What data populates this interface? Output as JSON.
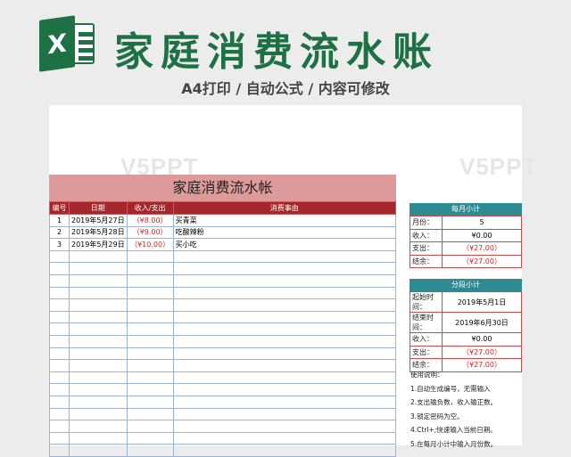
{
  "banner": {
    "logo_letter": "X",
    "title": "家庭消费流水账",
    "subtitle": "A4打印 / 自动公式 / 内容可修改"
  },
  "watermark": "V5PPT",
  "sheet": {
    "title": "家庭消费流水帐",
    "columns": [
      "编号",
      "日期",
      "收入/支出",
      "消费事由"
    ],
    "rows": [
      {
        "no": "1",
        "date": "2019年5月27日",
        "amount": "（¥8.00）",
        "desc": "买青菜"
      },
      {
        "no": "2",
        "date": "2019年5月28日",
        "amount": "（¥9.00）",
        "desc": "吃酸辣粉"
      },
      {
        "no": "3",
        "date": "2019年5月29日",
        "amount": "（¥10.00）",
        "desc": "买小吃"
      }
    ],
    "empty_rows": 17
  },
  "monthly": {
    "title": "每月小计",
    "rows": [
      {
        "label": "月份：",
        "value": "5",
        "red": false
      },
      {
        "label": "收入：",
        "value": "¥0.00",
        "red": false
      },
      {
        "label": "支出：",
        "value": "（¥27.00）",
        "red": true
      },
      {
        "label": "结余：",
        "value": "（¥27.00）",
        "red": true
      }
    ]
  },
  "period": {
    "title": "分段小计",
    "rows": [
      {
        "label": "起始时间：",
        "value": "2019年5月1日",
        "red": false
      },
      {
        "label": "结束时间：",
        "value": "2019年6月30日",
        "red": false
      },
      {
        "label": "收入：",
        "value": "¥0.00",
        "red": false
      },
      {
        "label": "支出：",
        "value": "（¥27.00）",
        "red": true
      },
      {
        "label": "结余：",
        "value": "（¥27.00）",
        "red": true
      }
    ]
  },
  "notes": {
    "heading": "使用说明：",
    "items": [
      "1.自动生成编号，无需输入",
      "2.支出输负数，收入输正数。",
      "3.锁定密码为空。",
      "4.Ctrl+;快速输入当前日期。",
      "5.在每月小计中输入月份数。"
    ]
  }
}
